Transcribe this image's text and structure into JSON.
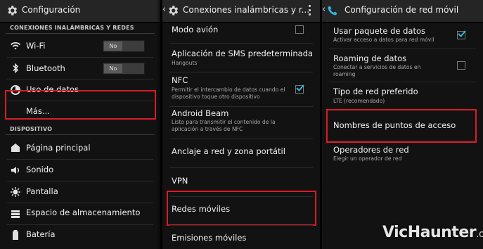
{
  "panel1": {
    "title": "Configuración",
    "section_wireless": "CONEXIONES INALÁMBRICAS Y REDES",
    "wifi": {
      "label": "Wi-Fi",
      "toggle": "No",
      "icon": "wifi-icon"
    },
    "bluetooth": {
      "label": "Bluetooth",
      "toggle": "No",
      "icon": "bluetooth-icon"
    },
    "data_usage": {
      "label": "Uso de datos",
      "icon": "data-usage-icon"
    },
    "more": {
      "label": "Más..."
    },
    "section_device": "DISPOSITIVO",
    "device_items": [
      {
        "label": "Página principal",
        "icon": "home-icon"
      },
      {
        "label": "Sonido",
        "icon": "sound-icon"
      },
      {
        "label": "Pantalla",
        "icon": "display-icon"
      },
      {
        "label": "Espacio de almacenamiento",
        "icon": "storage-icon"
      },
      {
        "label": "Batería",
        "icon": "battery-icon"
      }
    ]
  },
  "panel2": {
    "title": "Conexiones inalámbricas y r...",
    "items": [
      {
        "label": "Modo avión",
        "sub": "",
        "checked": false
      },
      {
        "label": "Aplicación de SMS predeterminada",
        "sub": "Hangouts"
      },
      {
        "label": "NFC",
        "sub": "Permitir el intercambio de datos cuando el dispositivo toque otro dispositivo",
        "checked": true
      },
      {
        "label": "Android Beam",
        "sub": "Listo para transmitir el contenido de la aplicación a través de NFC"
      },
      {
        "label": "Anclaje a red y zona portátil",
        "sub": ""
      },
      {
        "label": "VPN",
        "sub": ""
      },
      {
        "label": "Redes móviles",
        "sub": ""
      },
      {
        "label": "Emisiones móviles",
        "sub": ""
      }
    ]
  },
  "panel3": {
    "title": "Configuración de red móvil",
    "items": [
      {
        "label": "Usar paquete de datos",
        "sub": "Activar acceso a datos para red móvil",
        "checked": true
      },
      {
        "label": "Roaming de datos",
        "sub": "Conectar a servicios de datos en roaming",
        "checked": false
      },
      {
        "label": "Tipo de red preferido",
        "sub": "LTE (recomendado)"
      },
      {
        "label": "Nombres de puntos de acceso",
        "sub": ""
      },
      {
        "label": "Operadores de red",
        "sub": "Elegir un operador de red"
      }
    ]
  },
  "watermark": {
    "name": "VicHaunter",
    "tld": ".org"
  },
  "colors": {
    "highlight": "#d91c26",
    "accent": "#33b5e5",
    "background": "#121212"
  }
}
